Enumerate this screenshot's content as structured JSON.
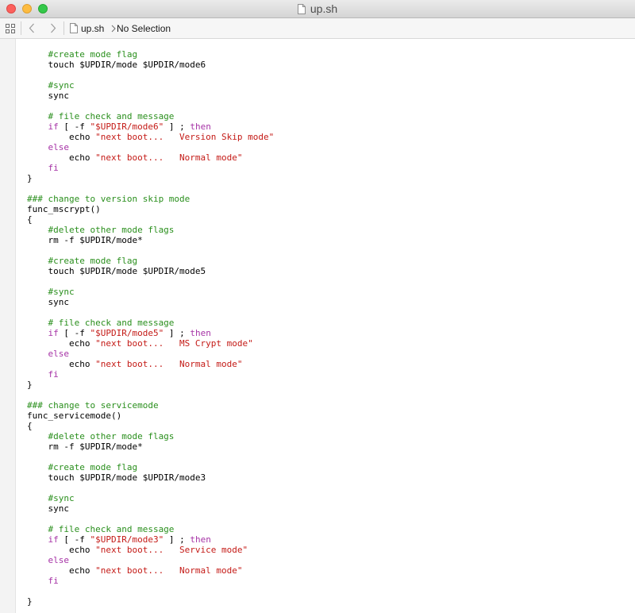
{
  "window": {
    "title": "up.sh",
    "controls": {
      "close": "close",
      "minimize": "minimize",
      "zoom": "zoom"
    }
  },
  "jumpbar": {
    "file": "up.sh",
    "selection": "No Selection",
    "icons": [
      "grid-icon",
      "back-arrow-icon",
      "forward-arrow-icon",
      "document-icon",
      "chevron-right-icon"
    ]
  },
  "colors": {
    "comment": "#2a8f1d",
    "keyword": "#a633a6",
    "string": "#c41a16",
    "plain": "#000000"
  },
  "code": {
    "lines": [
      [
        [
          "c",
          "    #create mode flag"
        ]
      ],
      [
        [
          "p",
          "    touch $UPDIR/mode $UPDIR/mode6"
        ]
      ],
      [],
      [
        [
          "c",
          "    #sync"
        ]
      ],
      [
        [
          "p",
          "    sync"
        ]
      ],
      [],
      [
        [
          "c",
          "    # file check and message"
        ]
      ],
      [
        [
          "p",
          "    "
        ],
        [
          "k",
          "if"
        ],
        [
          "p",
          " [ -f "
        ],
        [
          "s",
          "\"$UPDIR/mode6\""
        ],
        [
          "p",
          " ] ; "
        ],
        [
          "k",
          "then"
        ]
      ],
      [
        [
          "p",
          "        echo "
        ],
        [
          "s",
          "\"next boot...   Version Skip mode\""
        ]
      ],
      [
        [
          "p",
          "    "
        ],
        [
          "k",
          "else"
        ]
      ],
      [
        [
          "p",
          "        echo "
        ],
        [
          "s",
          "\"next boot...   Normal mode\""
        ]
      ],
      [
        [
          "p",
          "    "
        ],
        [
          "k",
          "fi"
        ]
      ],
      [
        [
          "p",
          "}"
        ]
      ],
      [],
      [
        [
          "c",
          "### change to version skip mode"
        ]
      ],
      [
        [
          "p",
          "func_mscrypt()"
        ]
      ],
      [
        [
          "p",
          "{"
        ]
      ],
      [
        [
          "c",
          "    #delete other mode flags"
        ]
      ],
      [
        [
          "p",
          "    rm -f $UPDIR/mode*"
        ]
      ],
      [],
      [
        [
          "c",
          "    #create mode flag"
        ]
      ],
      [
        [
          "p",
          "    touch $UPDIR/mode $UPDIR/mode5"
        ]
      ],
      [],
      [
        [
          "c",
          "    #sync"
        ]
      ],
      [
        [
          "p",
          "    sync"
        ]
      ],
      [],
      [
        [
          "c",
          "    # file check and message"
        ]
      ],
      [
        [
          "p",
          "    "
        ],
        [
          "k",
          "if"
        ],
        [
          "p",
          " [ -f "
        ],
        [
          "s",
          "\"$UPDIR/mode5\""
        ],
        [
          "p",
          " ] ; "
        ],
        [
          "k",
          "then"
        ]
      ],
      [
        [
          "p",
          "        echo "
        ],
        [
          "s",
          "\"next boot...   MS Crypt mode\""
        ]
      ],
      [
        [
          "p",
          "    "
        ],
        [
          "k",
          "else"
        ]
      ],
      [
        [
          "p",
          "        echo "
        ],
        [
          "s",
          "\"next boot...   Normal mode\""
        ]
      ],
      [
        [
          "p",
          "    "
        ],
        [
          "k",
          "fi"
        ]
      ],
      [
        [
          "p",
          "}"
        ]
      ],
      [],
      [
        [
          "c",
          "### change to servicemode"
        ]
      ],
      [
        [
          "p",
          "func_servicemode()"
        ]
      ],
      [
        [
          "p",
          "{"
        ]
      ],
      [
        [
          "c",
          "    #delete other mode flags"
        ]
      ],
      [
        [
          "p",
          "    rm -f $UPDIR/mode*"
        ]
      ],
      [],
      [
        [
          "c",
          "    #create mode flag"
        ]
      ],
      [
        [
          "p",
          "    touch $UPDIR/mode $UPDIR/mode3"
        ]
      ],
      [],
      [
        [
          "c",
          "    #sync"
        ]
      ],
      [
        [
          "p",
          "    sync"
        ]
      ],
      [],
      [
        [
          "c",
          "    # file check and message"
        ]
      ],
      [
        [
          "p",
          "    "
        ],
        [
          "k",
          "if"
        ],
        [
          "p",
          " [ -f "
        ],
        [
          "s",
          "\"$UPDIR/mode3\""
        ],
        [
          "p",
          " ] ; "
        ],
        [
          "k",
          "then"
        ]
      ],
      [
        [
          "p",
          "        echo "
        ],
        [
          "s",
          "\"next boot...   Service mode\""
        ]
      ],
      [
        [
          "p",
          "    "
        ],
        [
          "k",
          "else"
        ]
      ],
      [
        [
          "p",
          "        echo "
        ],
        [
          "s",
          "\"next boot...   Normal mode\""
        ]
      ],
      [
        [
          "p",
          "    "
        ],
        [
          "k",
          "fi"
        ]
      ],
      [],
      [
        [
          "p",
          "}"
        ]
      ]
    ]
  }
}
